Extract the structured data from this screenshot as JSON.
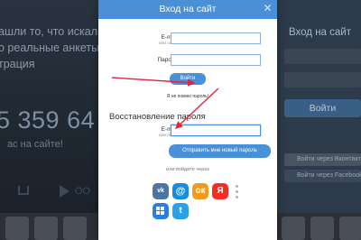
{
  "background": {
    "line1": "ашли то, что искали",
    "line2": "о реальные анкеты",
    "line3": "трация",
    "counter": "5 359 64",
    "counter_sub": "ас на сайте!",
    "more_text": "ОО",
    "right_panel": {
      "title": "Вход на сайт",
      "login_button": "Войти",
      "social_1": "Войти через Вконтакте",
      "social_2": "Войти через Facebook"
    }
  },
  "modal": {
    "title": "Вход на сайт",
    "close_glyph": "✕",
    "email_label": "E-mail",
    "email_sublabel": "или логин",
    "email_value": "",
    "password_label": "Пароль",
    "password_value": "",
    "login_button": "Войти",
    "forgot_link": "Я не помню пароль!",
    "recovery_title": "Восстановление пароля",
    "recovery_email_label": "E-mail",
    "recovery_email_sublabel": "или логин",
    "recovery_email_value": "",
    "send_button": "Отправить мне новый пароль",
    "or_login_with": "или войдите через",
    "social": {
      "vk": "vk",
      "mail": "@",
      "ok": "ок",
      "yandex": "Я",
      "twitter": "t"
    }
  },
  "colors": {
    "accent": "#4a90d9",
    "arrow": "#e0283a",
    "vk": "#4c75a3",
    "mail": "#168de2",
    "ok": "#f39a1c",
    "yandex": "#f32c24",
    "windows": "#2a7ee0",
    "twitter": "#2aa0ea"
  }
}
